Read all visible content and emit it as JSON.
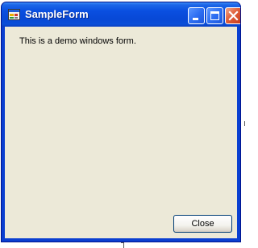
{
  "window": {
    "title": "SampleForm",
    "icon": "form-app-icon",
    "controls": {
      "minimize_icon": "minimize-icon",
      "maximize_icon": "maximize-icon",
      "close_icon": "close-icon"
    }
  },
  "content": {
    "message": "This is a demo windows form.",
    "close_button_label": "Close"
  },
  "colors": {
    "titlebar": "#0848d6",
    "client_background": "#ece9d8",
    "close_control": "#e0603a"
  }
}
